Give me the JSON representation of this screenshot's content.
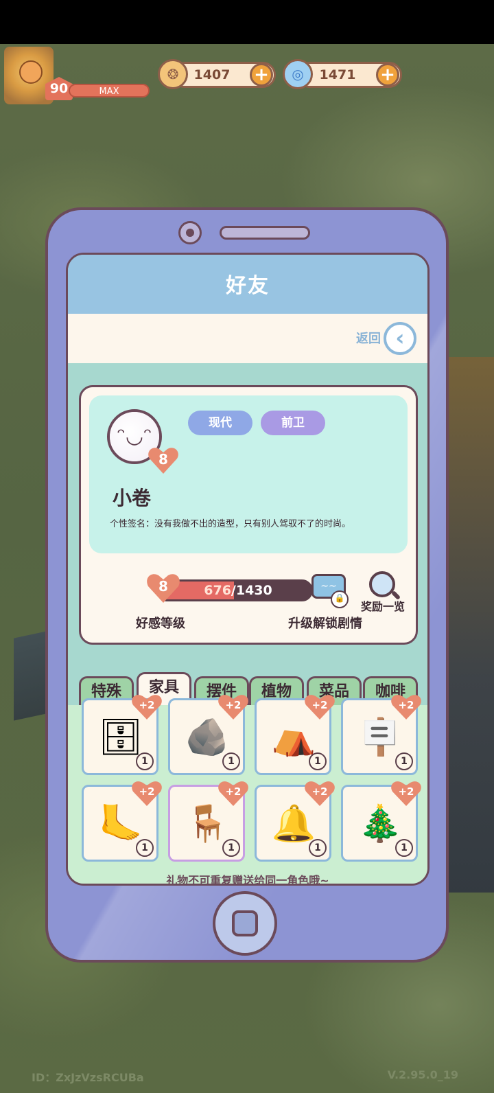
{
  "hud": {
    "player_level": "90",
    "level_status": "MAX",
    "coins": "1407",
    "gems": "1471",
    "coin_icon": "coin-icon",
    "gem_icon": "swirl-gem-icon"
  },
  "screen": {
    "title": "好友",
    "back_label": "返回"
  },
  "character": {
    "name": "小卷",
    "avatar_level": "8",
    "tags": [
      "现代",
      "前卫"
    ],
    "signature": "个性签名：没有我做不出的造型，只有别人驾驭不了的时尚。"
  },
  "affection": {
    "level": "8",
    "current": "676",
    "separator_max": "/1430",
    "progress": 0.473,
    "level_label": "好感等级",
    "unlock_label": "升级解锁剧情",
    "reward_label": "奖励一览"
  },
  "tabs": [
    "特殊",
    "家具",
    "摆件",
    "植物",
    "菜品",
    "咖啡"
  ],
  "active_tab": 1,
  "items": [
    {
      "name": "shelf",
      "icon": "🗄",
      "bonus": "+2",
      "count": "1"
    },
    {
      "name": "moss-rock",
      "icon": "🪨",
      "bonus": "+2",
      "count": "1"
    },
    {
      "name": "tent",
      "icon": "⛺",
      "bonus": "+2",
      "count": "1"
    },
    {
      "name": "signpost-lamp",
      "icon": "🪧",
      "bonus": "+2",
      "count": "1"
    },
    {
      "name": "fossil-footprint",
      "icon": "🦶",
      "bonus": "+2",
      "count": "1"
    },
    {
      "name": "glass-table",
      "icon": "🪑",
      "bonus": "+2",
      "count": "1"
    },
    {
      "name": "christmas-wreath",
      "icon": "🔔",
      "bonus": "+2",
      "count": "1"
    },
    {
      "name": "christmas-tree",
      "icon": "🎄",
      "bonus": "+2",
      "count": "1"
    }
  ],
  "notice": "礼物不可重复赠送给同一角色哦~",
  "footer": {
    "id": "ID：ZxJzVzsRCUBa",
    "version": "V.2.95.0_19"
  },
  "colors": {
    "accent_red": "#e46a64",
    "heart": "#e88a6f",
    "tag_blue": "#8fa8e6",
    "tag_purple": "#a99ae4",
    "phone_body": "#8d94d3"
  }
}
